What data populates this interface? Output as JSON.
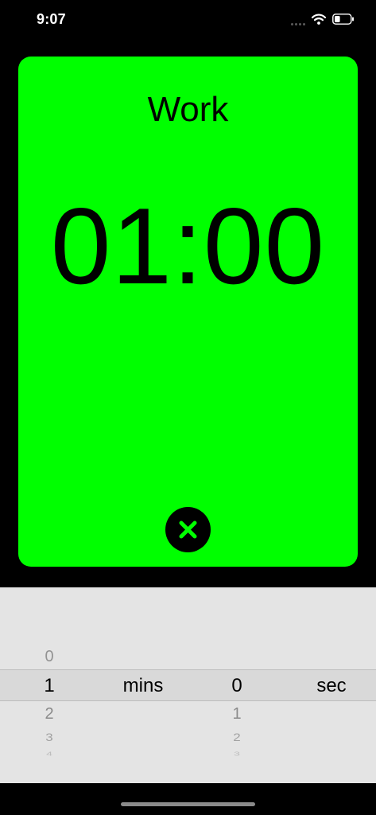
{
  "status_bar": {
    "time": "9:07",
    "icons": [
      "signal-dots-icon",
      "wifi-icon",
      "battery-icon"
    ],
    "battery_level": 0.35
  },
  "timer": {
    "phase": "Work",
    "time": "01:00",
    "card_color": "#00ff00",
    "close_icon": "close-icon"
  },
  "picker": {
    "minutes": {
      "above": [
        "0"
      ],
      "selected": "1",
      "below": [
        "2",
        "3",
        "4"
      ],
      "unit": "mins"
    },
    "seconds": {
      "above": [],
      "selected": "0",
      "below": [
        "1",
        "2",
        "3"
      ],
      "unit": "sec"
    }
  }
}
